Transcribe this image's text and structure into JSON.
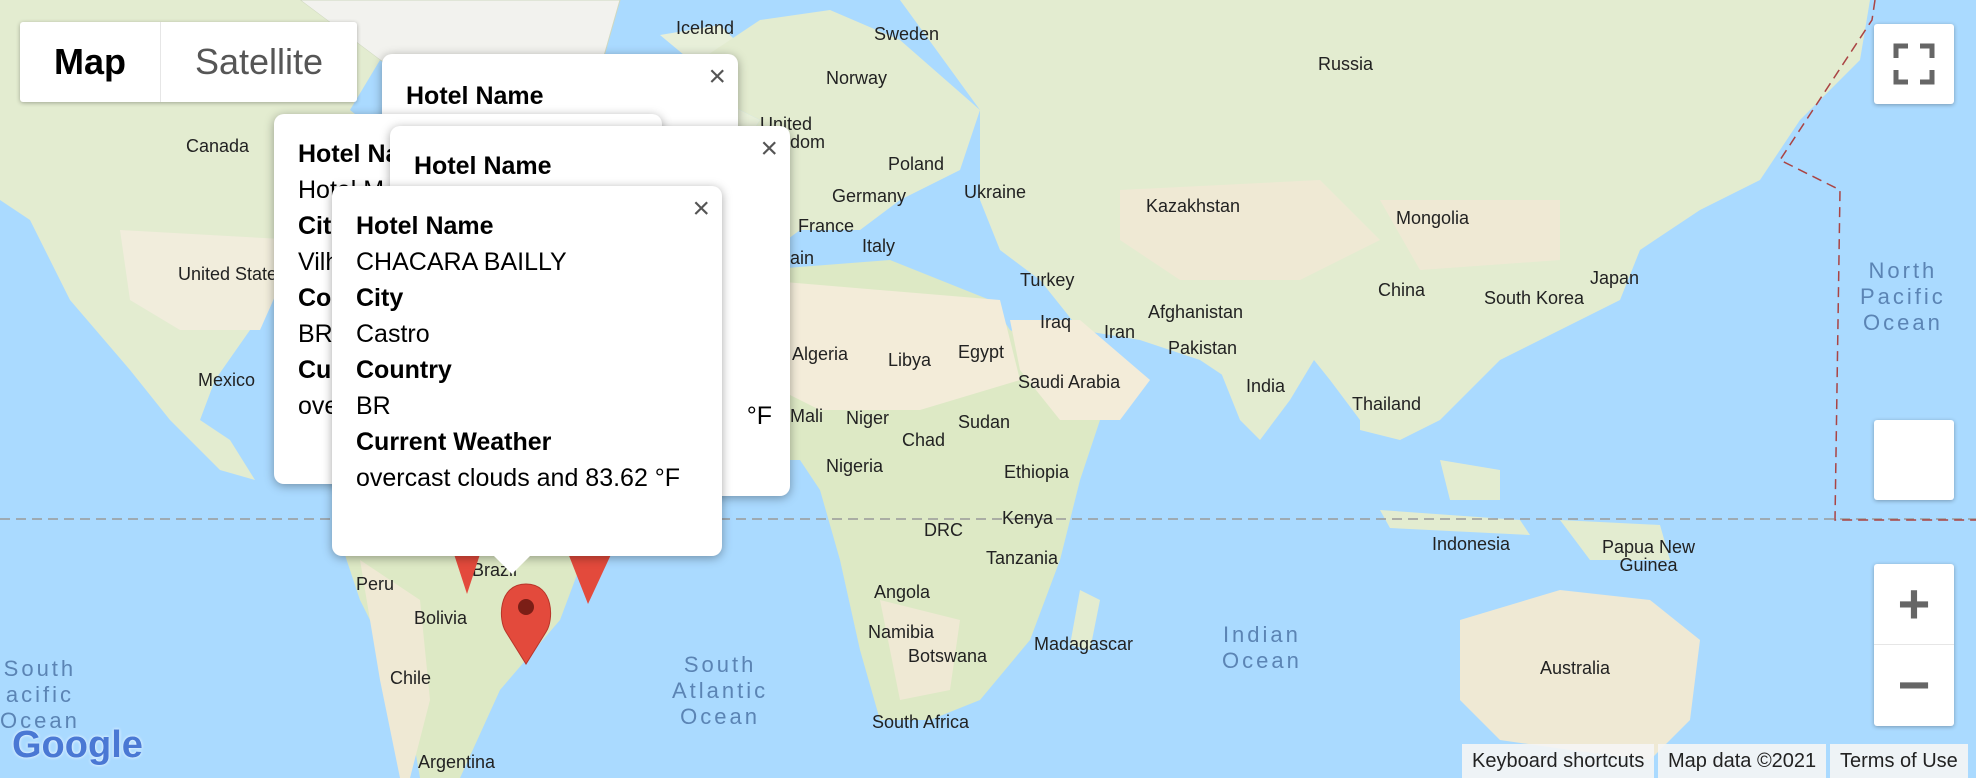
{
  "map_controls": {
    "map_label": "Map",
    "satellite_label": "Satellite"
  },
  "labels": {
    "iceland": "Iceland",
    "sweden": "Sweden",
    "norway": "Norway",
    "russia": "Russia",
    "canada": "Canada",
    "united_kingdom_1": "United",
    "united_kingdom_2": "dom",
    "poland": "Poland",
    "germany": "Germany",
    "ukraine": "Ukraine",
    "kazakhstan": "Kazakhstan",
    "mongolia": "Mongolia",
    "france": "France",
    "italy": "Italy",
    "spain_fragment": "ain",
    "united_states": "United States",
    "turkey": "Turkey",
    "china": "China",
    "japan": "Japan",
    "south_korea": "South Korea",
    "afghanistan": "Afghanistan",
    "iraq": "Iraq",
    "iran": "Iran",
    "pakistan": "Pakistan",
    "algeria": "Algeria",
    "libya": "Libya",
    "egypt": "Egypt",
    "saudi_arabia": "Saudi Arabia",
    "mexico": "Mexico",
    "india": "India",
    "thailand": "Thailand",
    "mali": "Mali",
    "niger": "Niger",
    "sudan": "Sudan",
    "chad": "Chad",
    "nigeria": "Nigeria",
    "ethiopia": "Ethiopia",
    "kenya": "Kenya",
    "drc": "DRC",
    "tanzania": "Tanzania",
    "indonesia": "Indonesia",
    "papua_new_guinea": "Papua New\nGuinea",
    "peru": "Peru",
    "brazil_fragment": "Brazil",
    "bolivia": "Bolivia",
    "angola": "Angola",
    "namibia": "Namibia",
    "botswana": "Botswana",
    "madagascar": "Madagascar",
    "australia": "Australia",
    "chile": "Chile",
    "south_africa": "South Africa",
    "argentina": "Argentina"
  },
  "oceans": {
    "north_pacific": "North\nPacific\nOcean",
    "south_pacific": "South\nacific\nOcean",
    "south_atlantic": "South\nAtlantic\nOcean",
    "indian": "Indian\nOcean"
  },
  "popups": {
    "back1": {
      "heading": "Hotel Name"
    },
    "back2": {
      "heading": "Hotel Na",
      "name_fragment": "Hotel M",
      "city_fragment": "Cit",
      "city_value_fragment": "Vilh",
      "country_fragment": "Co",
      "country_value_fragment": "BR",
      "weather_fragment": "Cur",
      "weather_value_fragment": "ove"
    },
    "back3": {
      "heading": "Hotel Name",
      "unit_fragment": "°F"
    },
    "front": {
      "hotel_label": "Hotel Name",
      "hotel_value": "CHACARA BAILLY",
      "city_label": "City",
      "city_value": "Castro",
      "country_label": "Country",
      "country_value": "BR",
      "weather_label": "Current Weather",
      "weather_value": "overcast clouds and 83.62 °F"
    }
  },
  "close_glyph": "×",
  "logo_text": "Google",
  "footer": {
    "keyboard_shortcuts": "Keyboard shortcuts",
    "map_data": "Map data ©2021",
    "terms": "Terms of Use"
  },
  "zoom": {
    "plus": "+",
    "minus": "−"
  },
  "icons": [
    "fullscreen-icon",
    "zoom-in-icon",
    "zoom-out-icon",
    "close-icon",
    "map-marker-icon",
    "google-logo"
  ],
  "colors": {
    "water": "#aadaff",
    "land": "#e8efd9",
    "desert": "#f3ecd9",
    "marker": "#e34a3c",
    "ocean_label": "#5b84b4"
  }
}
